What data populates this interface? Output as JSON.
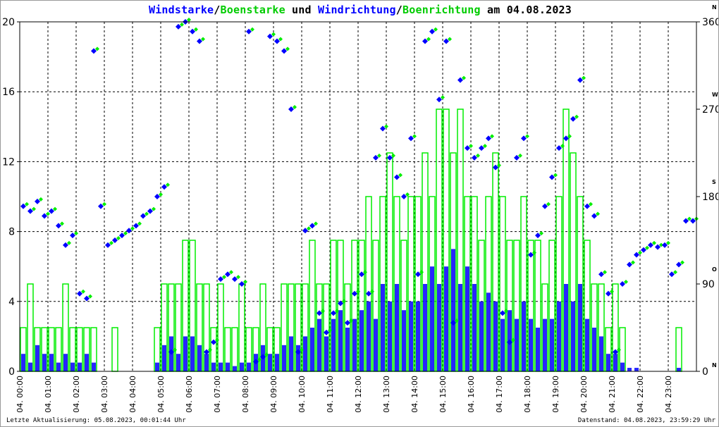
{
  "title": {
    "part1": "Windstarke",
    "sep1": "/",
    "part2": "Boenstarke",
    "mid": " und ",
    "part3": "Windrichtung",
    "sep2": "/",
    "part4": "Boenrichtung",
    "tail": " am 04.08.2023"
  },
  "footer": {
    "last_update": "Letzte Aktualisierung: 05.08.2023, 00:01:44 Uhr",
    "data_state": "Datenstand: 04.08.2023, 23:59:29 Uhr"
  },
  "colors": {
    "speed": "#0000ff",
    "gust": "#00ee00",
    "direction": "#0000ff",
    "gust_direction": "#00ee00"
  },
  "chart_data": {
    "type": "bar",
    "title": "Windstarke/Boenstarke und Windrichtung/Boenrichtung am 04.08.2023",
    "ylim": [
      0,
      20
    ],
    "y_ticks": [
      "0",
      "4",
      "8",
      "12",
      "16",
      "20"
    ],
    "y2lim": [
      0,
      360
    ],
    "y2_ticks": [
      "0",
      "90",
      "180",
      "270",
      "360"
    ],
    "y2_compass": [
      "N",
      "O",
      "S",
      "W",
      "N"
    ],
    "x_ticks": [
      "04. 00:00",
      "04. 01:00",
      "04. 02:00",
      "04. 03:00",
      "04. 04:00",
      "04. 05:00",
      "04. 06:00",
      "04. 07:00",
      "04. 08:00",
      "04. 09:00",
      "04. 10:00",
      "04. 11:00",
      "04. 12:00",
      "04. 13:00",
      "04. 14:00",
      "04. 15:00",
      "04. 16:00",
      "04. 17:00",
      "04. 18:00",
      "04. 19:00",
      "04. 20:00",
      "04. 21:00",
      "04. 22:00",
      "04. 23:00"
    ],
    "x_unit": "hours (15-min samples)",
    "grid": true,
    "series": [
      {
        "name": "Windstarke",
        "values": [
          1,
          0.5,
          1.5,
          1,
          1,
          0.5,
          1,
          0.5,
          0.5,
          1,
          0.5,
          0,
          0,
          0,
          0,
          0,
          0,
          0,
          0,
          0.5,
          1.5,
          2,
          1,
          2,
          2,
          1.5,
          1,
          0.5,
          0.5,
          0.5,
          0.3,
          0.5,
          0.5,
          1,
          1.5,
          1,
          1,
          1.5,
          2,
          1.5,
          2,
          2.5,
          3,
          2,
          3,
          3.5,
          2.5,
          3,
          3.5,
          4,
          3,
          5,
          4,
          5,
          3.5,
          4,
          4,
          5,
          6,
          5,
          6,
          7,
          5,
          6,
          5,
          4,
          4.5,
          4,
          3,
          3.5,
          3,
          4,
          3,
          2.5,
          3,
          3,
          4,
          5,
          4,
          5,
          3,
          2.5,
          2,
          1,
          1,
          0.5,
          0.2,
          0.2,
          0,
          0,
          0,
          0,
          0,
          0.2,
          0,
          0
        ]
      },
      {
        "name": "Boenstarke",
        "values": [
          2.5,
          5,
          2.5,
          2.5,
          2.5,
          2.5,
          5,
          2.5,
          2.5,
          2.5,
          2.5,
          0,
          0,
          2.5,
          0,
          0,
          0,
          0,
          0,
          2.5,
          5,
          5,
          5,
          7.5,
          7.5,
          5,
          5,
          2.5,
          5,
          2.5,
          2.5,
          5,
          2.5,
          2.5,
          5,
          2.5,
          2.5,
          5,
          5,
          5,
          5,
          7.5,
          5,
          5,
          7.5,
          7.5,
          5,
          7.5,
          7.5,
          10,
          7.5,
          10,
          12.5,
          10,
          7.5,
          10,
          10,
          12.5,
          10,
          15,
          15,
          12.5,
          15,
          10,
          10,
          7.5,
          10,
          12.5,
          10,
          7.5,
          7.5,
          10,
          7.5,
          7.5,
          5,
          7.5,
          10,
          15,
          12.5,
          10,
          7.5,
          5,
          5,
          2.5,
          5,
          2.5,
          0,
          0,
          0,
          0,
          0,
          0,
          0,
          2.5,
          0,
          0
        ]
      },
      {
        "name": "Windrichtung",
        "values": [
          170,
          165,
          175,
          160,
          165,
          150,
          130,
          140,
          80,
          75,
          330,
          170,
          130,
          135,
          140,
          145,
          150,
          160,
          165,
          180,
          190,
          20,
          355,
          360,
          350,
          340,
          20,
          30,
          95,
          100,
          95,
          90,
          350,
          10,
          15,
          345,
          340,
          330,
          270,
          20,
          145,
          150,
          60,
          40,
          60,
          70,
          50,
          80,
          100,
          80,
          220,
          250,
          220,
          200,
          180,
          240,
          100,
          340,
          350,
          280,
          340,
          50,
          300,
          230,
          220,
          230,
          240,
          210,
          60,
          30,
          220,
          240,
          120,
          140,
          170,
          200,
          230,
          240,
          260,
          300,
          170,
          160,
          100,
          80,
          20,
          90,
          110,
          120,
          125,
          130,
          128,
          130,
          100,
          110,
          155,
          155
        ]
      }
    ]
  }
}
